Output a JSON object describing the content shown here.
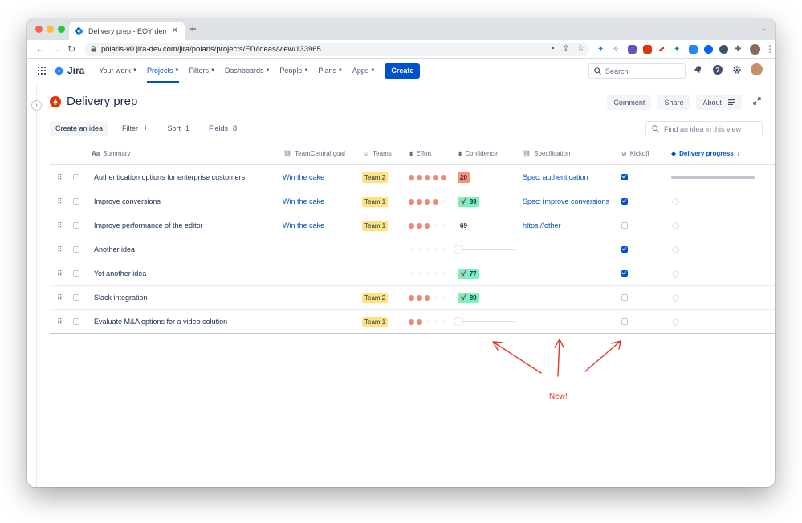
{
  "browser": {
    "tab_title": "Delivery prep - EOY demo - Jira",
    "url": "polaris-v0.jira-dev.com/jira/polaris/projects/ED/ideas/view/133965"
  },
  "nav": {
    "logo_text": "Jira",
    "items": [
      {
        "label": "Your work",
        "active": false
      },
      {
        "label": "Projects",
        "active": true
      },
      {
        "label": "Filters",
        "active": false
      },
      {
        "label": "Dashboards",
        "active": false
      },
      {
        "label": "People",
        "active": false
      },
      {
        "label": "Plans",
        "active": false
      },
      {
        "label": "Apps",
        "active": false
      }
    ],
    "create_label": "Create",
    "search_placeholder": "Search"
  },
  "page": {
    "title": "Delivery prep",
    "buttons": {
      "comment": "Comment",
      "share": "Share",
      "about": "About"
    }
  },
  "toolbar": {
    "create_idea": "Create an idea",
    "filter": "Filter",
    "sort_label": "Sort",
    "sort_count": "1",
    "fields_label": "Fields",
    "fields_count": "8",
    "find_placeholder": "Find an idea in this view"
  },
  "table": {
    "columns": {
      "summary": "Summary",
      "goal": "TeamCentral goal",
      "teams": "Teams",
      "effort": "Effort",
      "confidence": "Confidence",
      "spec": "Specification",
      "kickoff": "Kickoff",
      "progress": "Delivery progress"
    },
    "rows": [
      {
        "summary": "Authentication options for enterprise customers",
        "goal": "Win the cake",
        "team": "Team 2",
        "effort": 5,
        "confidence": "20",
        "confidence_style": "red",
        "spec": "Spec: authentication",
        "kickoff": true,
        "progress": 1.0
      },
      {
        "summary": "Improve conversions",
        "goal": "Win the cake",
        "team": "Team 1",
        "effort": 4,
        "confidence": "89",
        "confidence_style": "green",
        "spec": "Spec: improve conversions",
        "kickoff": true,
        "progress": null
      },
      {
        "summary": "Improve performance of the editor",
        "goal": "Win the cake",
        "team": "Team 1",
        "effort": 3,
        "confidence": "69",
        "confidence_style": "plain",
        "spec": "https://other",
        "kickoff": false,
        "progress": null
      },
      {
        "summary": "Another idea",
        "goal": "",
        "team": "",
        "effort": 0,
        "confidence": "",
        "confidence_style": "slider",
        "spec": "",
        "kickoff": true,
        "progress": null
      },
      {
        "summary": "Yet another idea",
        "goal": "",
        "team": "",
        "effort": 0,
        "confidence": "77",
        "confidence_style": "green",
        "spec": "",
        "kickoff": true,
        "progress": null
      },
      {
        "summary": "Slack integration",
        "goal": "",
        "team": "Team 2",
        "effort": 3,
        "confidence": "89",
        "confidence_style": "green",
        "spec": "",
        "kickoff": false,
        "progress": null
      },
      {
        "summary": "Evaluate M&A options for a video solution",
        "goal": "",
        "team": "Team 1",
        "effort": 2,
        "confidence": "",
        "confidence_style": "slider",
        "spec": "",
        "kickoff": false,
        "progress": null
      }
    ]
  },
  "annotation": {
    "label": "New!",
    "color": "#e5372b"
  }
}
